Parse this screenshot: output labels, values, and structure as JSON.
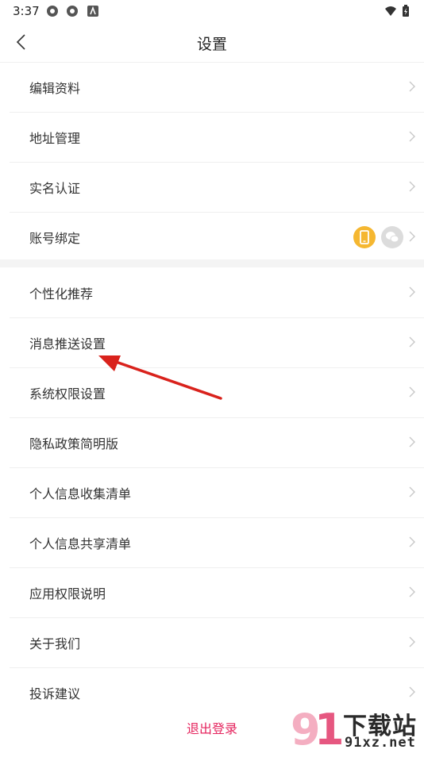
{
  "status_bar": {
    "time": "3:37"
  },
  "header": {
    "title": "设置"
  },
  "group1": [
    {
      "label": "编辑资料"
    },
    {
      "label": "地址管理"
    },
    {
      "label": "实名认证"
    },
    {
      "label": "账号绑定"
    }
  ],
  "group2": [
    {
      "label": "个性化推荐"
    },
    {
      "label": "消息推送设置"
    },
    {
      "label": "系统权限设置"
    },
    {
      "label": "隐私政策简明版"
    },
    {
      "label": "个人信息收集清单"
    },
    {
      "label": "个人信息共享清单"
    },
    {
      "label": "应用权限说明"
    },
    {
      "label": "关于我们"
    },
    {
      "label": "投诉建议"
    }
  ],
  "logout_label": "退出登录",
  "watermark": {
    "brand": "下载站",
    "domain": "91xz.net"
  },
  "colors": {
    "accent": "#e5245e",
    "phone_badge": "#f5b731",
    "arrow": "#d9221c"
  }
}
